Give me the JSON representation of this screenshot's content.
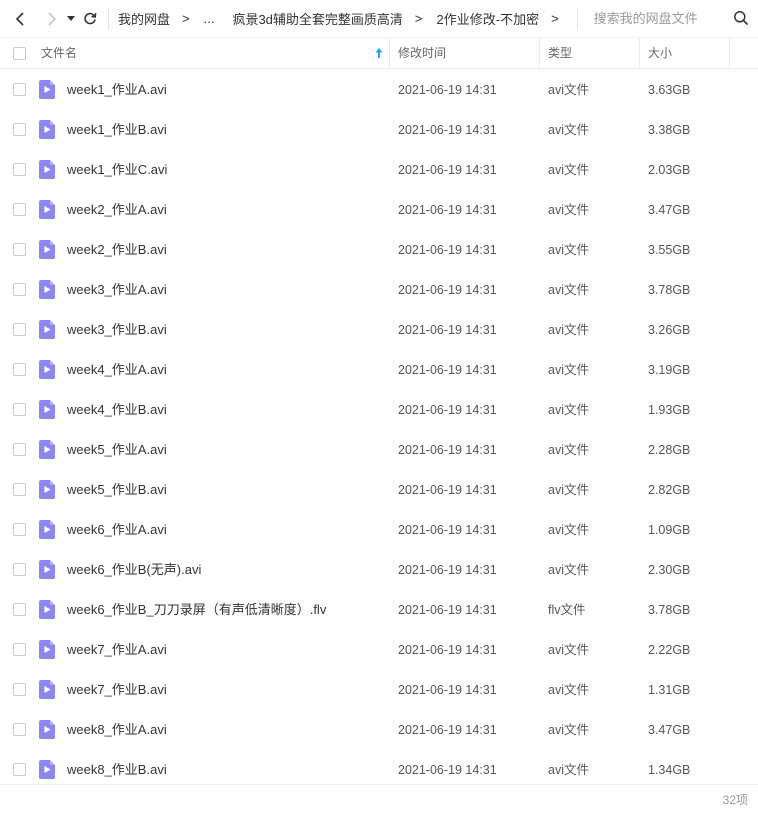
{
  "toolbar": {
    "breadcrumb": {
      "root": "我的网盘",
      "ellipsis": "...",
      "parent": "疯景3d辅助全套完整画质高清",
      "current": "2作业修改-不加密"
    },
    "search_placeholder": "搜索我的网盘文件",
    "arrow": ">"
  },
  "columns": {
    "name": "文件名",
    "modified": "修改时间",
    "type": "类型",
    "size": "大小"
  },
  "files": [
    {
      "name": "week1_作业A.avi",
      "modified": "2021-06-19 14:31",
      "type": "avi文件",
      "size": "3.63GB"
    },
    {
      "name": "week1_作业B.avi",
      "modified": "2021-06-19 14:31",
      "type": "avi文件",
      "size": "3.38GB"
    },
    {
      "name": "week1_作业C.avi",
      "modified": "2021-06-19 14:31",
      "type": "avi文件",
      "size": "2.03GB"
    },
    {
      "name": "week2_作业A.avi",
      "modified": "2021-06-19 14:31",
      "type": "avi文件",
      "size": "3.47GB"
    },
    {
      "name": "week2_作业B.avi",
      "modified": "2021-06-19 14:31",
      "type": "avi文件",
      "size": "3.55GB"
    },
    {
      "name": "week3_作业A.avi",
      "modified": "2021-06-19 14:31",
      "type": "avi文件",
      "size": "3.78GB"
    },
    {
      "name": "week3_作业B.avi",
      "modified": "2021-06-19 14:31",
      "type": "avi文件",
      "size": "3.26GB"
    },
    {
      "name": "week4_作业A.avi",
      "modified": "2021-06-19 14:31",
      "type": "avi文件",
      "size": "3.19GB"
    },
    {
      "name": "week4_作业B.avi",
      "modified": "2021-06-19 14:31",
      "type": "avi文件",
      "size": "1.93GB"
    },
    {
      "name": "week5_作业A.avi",
      "modified": "2021-06-19 14:31",
      "type": "avi文件",
      "size": "2.28GB"
    },
    {
      "name": "week5_作业B.avi",
      "modified": "2021-06-19 14:31",
      "type": "avi文件",
      "size": "2.82GB"
    },
    {
      "name": "week6_作业A.avi",
      "modified": "2021-06-19 14:31",
      "type": "avi文件",
      "size": "1.09GB"
    },
    {
      "name": "week6_作业B(无声).avi",
      "modified": "2021-06-19 14:31",
      "type": "avi文件",
      "size": "2.30GB"
    },
    {
      "name": "week6_作业B_刀刀录屏（有声低清晰度）.flv",
      "modified": "2021-06-19 14:31",
      "type": "flv文件",
      "size": "3.78GB"
    },
    {
      "name": "week7_作业A.avi",
      "modified": "2021-06-19 14:31",
      "type": "avi文件",
      "size": "2.22GB"
    },
    {
      "name": "week7_作业B.avi",
      "modified": "2021-06-19 14:31",
      "type": "avi文件",
      "size": "1.31GB"
    },
    {
      "name": "week8_作业A.avi",
      "modified": "2021-06-19 14:31",
      "type": "avi文件",
      "size": "3.47GB"
    },
    {
      "name": "week8_作业B.avi",
      "modified": "2021-06-19 14:31",
      "type": "avi文件",
      "size": "1.34GB"
    }
  ],
  "footer": {
    "item_count": "32项"
  },
  "colors": {
    "file_icon": "#8b86f0",
    "sort_arrow": "#2aa3ef",
    "divider": "#f0f0f0"
  }
}
